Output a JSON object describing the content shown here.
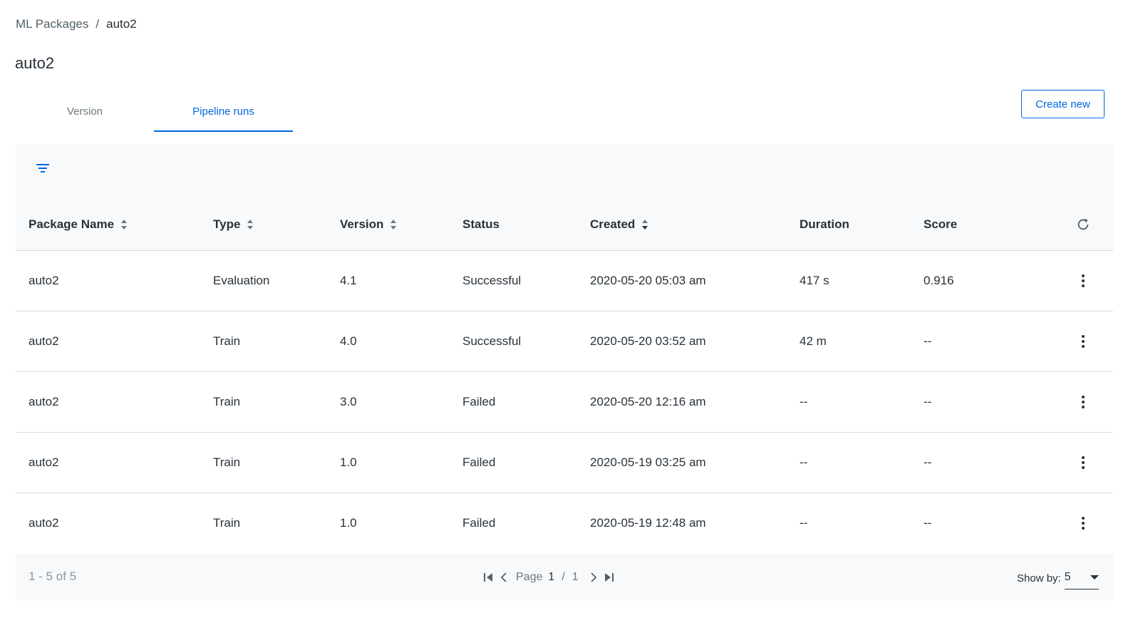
{
  "breadcrumb": {
    "parent": "ML Packages",
    "separator": "/",
    "current": "auto2"
  },
  "page": {
    "title": "auto2"
  },
  "tabs": [
    {
      "label": "Version",
      "active": false
    },
    {
      "label": "Pipeline runs",
      "active": true
    }
  ],
  "actions": {
    "create_label": "Create new"
  },
  "table": {
    "columns": [
      {
        "label": "Package Name",
        "sortable": true
      },
      {
        "label": "Type",
        "sortable": true
      },
      {
        "label": "Version",
        "sortable": true
      },
      {
        "label": "Status",
        "sortable": false
      },
      {
        "label": "Created",
        "sortable": true
      },
      {
        "label": "Duration",
        "sortable": false
      },
      {
        "label": "Score",
        "sortable": false
      }
    ],
    "rows": [
      {
        "package": "auto2",
        "type": "Evaluation",
        "version": "4.1",
        "status": "Successful",
        "created": "2020-05-20 05:03 am",
        "duration": "417 s",
        "score": "0.916"
      },
      {
        "package": "auto2",
        "type": "Train",
        "version": "4.0",
        "status": "Successful",
        "created": "2020-05-20 03:52 am",
        "duration": "42 m",
        "score": "--"
      },
      {
        "package": "auto2",
        "type": "Train",
        "version": "3.0",
        "status": "Failed",
        "created": "2020-05-20 12:16 am",
        "duration": "--",
        "score": "--"
      },
      {
        "package": "auto2",
        "type": "Train",
        "version": "1.0",
        "status": "Failed",
        "created": "2020-05-19 03:25 am",
        "duration": "--",
        "score": "--"
      },
      {
        "package": "auto2",
        "type": "Train",
        "version": "1.0",
        "status": "Failed",
        "created": "2020-05-19 12:48 am",
        "duration": "--",
        "score": "--"
      }
    ]
  },
  "footer": {
    "range": "1 - 5 of 5",
    "page_label": "Page",
    "page_current": "1",
    "page_separator": "/",
    "page_total": "1",
    "show_by_label": "Show by:",
    "show_by_value": "5"
  },
  "icons": {
    "filter": "filter-icon",
    "sort": "sort-icon",
    "refresh": "refresh-icon",
    "more": "more-vertical-icon",
    "first": "first-page-icon",
    "prev": "chevron-left-icon",
    "next": "chevron-right-icon",
    "last": "last-page-icon",
    "dropdown": "caret-down-icon"
  },
  "colors": {
    "accent": "#0067df",
    "text": "#273139",
    "muted": "#6b7882",
    "border": "#d7dbde",
    "grid_bg": "#f8f9fa"
  }
}
